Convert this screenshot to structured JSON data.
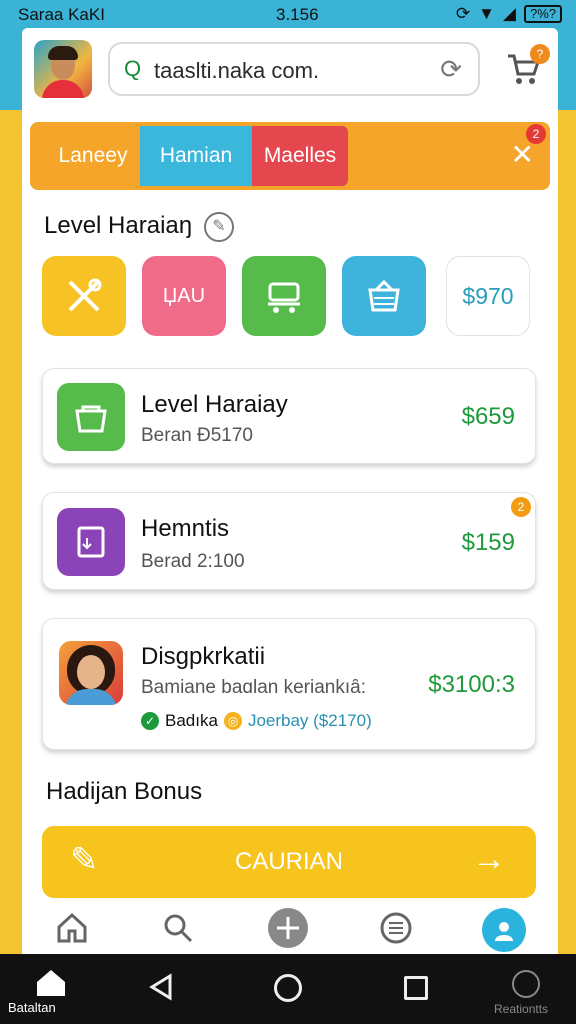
{
  "status_bar": {
    "carrier": "Saraa KaKI",
    "time": "3.156",
    "battery": "?%?"
  },
  "header": {
    "search_text": "taaslti.naka com."
  },
  "cart": {
    "badge": "?"
  },
  "tabs": [
    {
      "label": "Laneey"
    },
    {
      "label": "Hamian"
    },
    {
      "label": "Maelles"
    }
  ],
  "tabs_badge": "2",
  "section": {
    "title": "Level Haraiaŋ"
  },
  "tiles": [
    {
      "icon": "tools-icon",
      "color": "#f7c223"
    },
    {
      "icon": "sticker-icon",
      "color": "#f06a8a",
      "text": "ЏAU"
    },
    {
      "icon": "cart-icon",
      "color": "#56bb4a"
    },
    {
      "icon": "basket-icon",
      "color": "#3eb4dd"
    },
    {
      "price": "$970"
    }
  ],
  "rows": [
    {
      "title": "Level Haraiay",
      "subtitle": "Beran Ð5170",
      "price": "$659",
      "icon_color": "#56bb4a"
    },
    {
      "title": "Hemntis",
      "subtitle": "Berad 2:100",
      "price": "$159",
      "icon_color": "#8a44b8",
      "badge": "2"
    },
    {
      "title": "Disgpkrkatii",
      "subtitle": "Bamiane baɑlan keriankıȃ:",
      "price": "$3100:3",
      "tag1": "Badıka",
      "tag2": "Joerbay ($2170)"
    }
  ],
  "bonus": {
    "title": "Hadijan Bonus"
  },
  "cta": {
    "label": "CAURIAN"
  },
  "sysnav": {
    "home_label": "Bataltan",
    "right_label": "Reationtts"
  }
}
